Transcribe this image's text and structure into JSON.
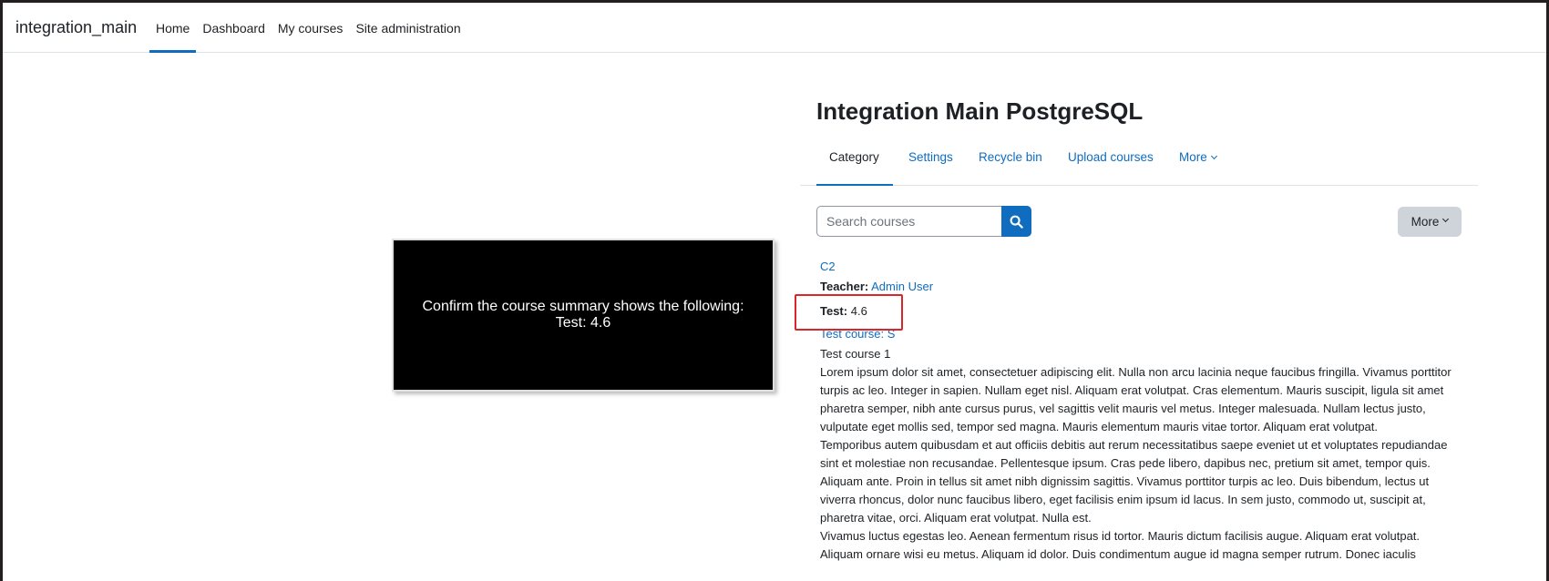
{
  "brand": "integration_main",
  "primary_nav": [
    {
      "label": "Home"
    },
    {
      "label": "Dashboard"
    },
    {
      "label": "My courses"
    },
    {
      "label": "Site administration"
    }
  ],
  "page_title": "Integration Main PostgreSQL",
  "secondary_nav": [
    {
      "label": "Category"
    },
    {
      "label": "Settings"
    },
    {
      "label": "Recycle bin"
    },
    {
      "label": "Upload courses"
    },
    {
      "label": "More"
    }
  ],
  "search": {
    "placeholder": "Search courses"
  },
  "more_button": "More",
  "courses": {
    "c2_link": "C2",
    "teacher_label": "Teacher:",
    "teacher_name": "Admin User",
    "test_label": "Test:",
    "test_value": "4.6",
    "test_course_link": "Test course: S",
    "course_name": "Test course 1",
    "paragraphs": [
      "Lorem ipsum dolor sit amet, consectetuer adipiscing elit. Nulla non arcu lacinia neque faucibus fringilla. Vivamus porttitor turpis ac leo. Integer in sapien. Nullam eget nisl. Aliquam erat volutpat. Cras elementum. Mauris suscipit, ligula sit amet pharetra semper, nibh ante cursus purus, vel sagittis velit mauris vel metus. Integer malesuada. Nullam lectus justo, vulputate eget mollis sed, tempor sed magna. Mauris elementum mauris vitae tortor. Aliquam erat volutpat.",
      "Temporibus autem quibusdam et aut officiis debitis aut rerum necessitatibus saepe eveniet ut et voluptates repudiandae sint et molestiae non recusandae. Pellentesque ipsum. Cras pede libero, dapibus nec, pretium sit amet, tempor quis. Aliquam ante. Proin in tellus sit amet nibh dignissim sagittis. Vivamus porttitor turpis ac leo. Duis bibendum, lectus ut viverra rhoncus, dolor nunc faucibus libero, eget facilisis enim ipsum id lacus. In sem justo, commodo ut, suscipit at, pharetra vitae, orci. Aliquam erat volutpat. Nulla est.",
      "Vivamus luctus egestas leo. Aenean fermentum risus id tortor. Mauris dictum facilisis augue. Aliquam erat volutpat. Aliquam ornare wisi eu metus. Aliquam id dolor. Duis condimentum augue id magna semper rutrum. Donec iaculis"
    ]
  },
  "overlay": {
    "line1": "Confirm the course summary shows the following:",
    "line2": "Test: 4.6"
  },
  "colors": {
    "accent": "#0f6cbf",
    "highlight": "#d9262b",
    "overlay_bg": "#000000"
  }
}
